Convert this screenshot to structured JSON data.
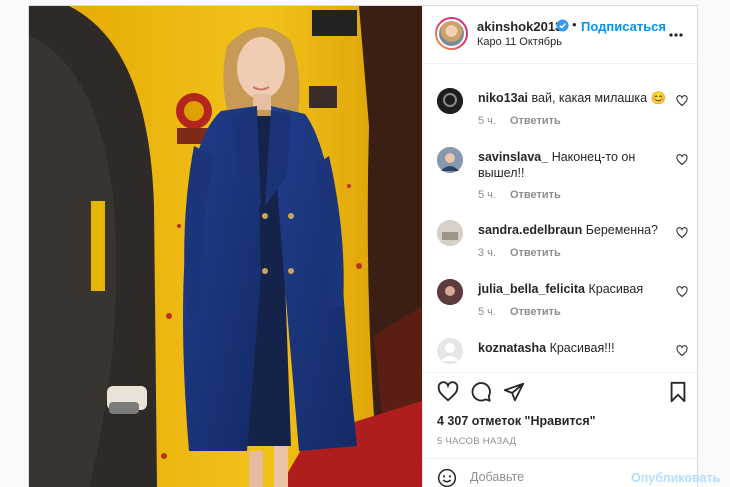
{
  "post": {
    "username": "akinshok2013",
    "separator": "•",
    "follow_label": "Подписаться",
    "location": "Каро 11 Октябрь",
    "likes": "4 307 отметок \"Нравится\"",
    "time_ago": "5 ЧАСОВ НАЗАД",
    "comment_placeholder": "Добавьте",
    "publish_label": "Опубликовать",
    "accent_color": "#0095f6"
  },
  "comments": [
    {
      "user": "niko13ai",
      "text": "вай, какая милашка 😊",
      "time": "5 ч.",
      "reply": "Ответить"
    },
    {
      "user": "savinslava_",
      "text": "Наконец-то он вышел!!",
      "time": "5 ч.",
      "reply": "Ответить"
    },
    {
      "user": "sandra.edelbraun",
      "text": "Беременна?",
      "time": "3 ч.",
      "reply": "Ответить"
    },
    {
      "user": "julia_bella_felicita",
      "text": "Красивая",
      "time": "5 ч.",
      "reply": "Ответить"
    },
    {
      "user": "koznatasha",
      "text": "Красивая!!!",
      "time": "",
      "reply": ""
    }
  ],
  "icons": [
    "verified-badge-icon",
    "more-options-icon",
    "heart-icon",
    "comment-icon",
    "share-icon",
    "bookmark-icon",
    "emoji-icon"
  ]
}
